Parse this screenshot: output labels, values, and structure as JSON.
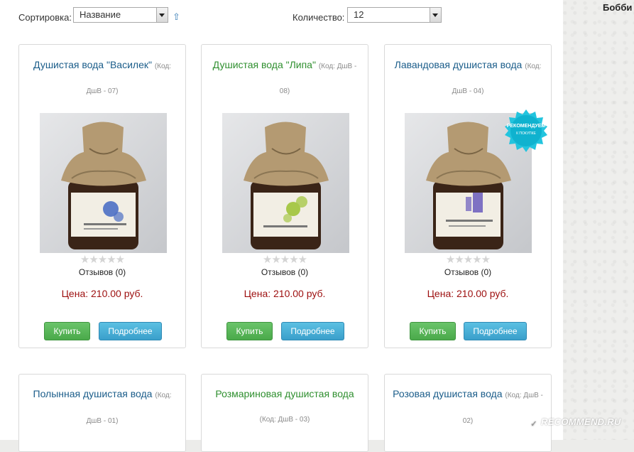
{
  "header": {
    "user_name": "Бобби"
  },
  "toolbar": {
    "sort_label": "Сортировка:",
    "sort_value": "Название",
    "quantity_label": "Количество:",
    "quantity_value": "12"
  },
  "products": [
    {
      "name": "Душистая вода \"Василек\"",
      "code_part1": "(Код:",
      "code_part2": "ДшВ - 07)",
      "title_color": "#1b5d8a",
      "label_text": "Душистая вода Василек",
      "flower_color": "#4d6fc4",
      "reviews": "Отзывов (0)",
      "price": "Цена: 210.00 руб.",
      "buy_label": "Купить",
      "details_label": "Подробнее",
      "rating": 0
    },
    {
      "name": "Душистая вода \"Липа\"",
      "code_part1": "(Код: ДшВ -",
      "code_part2": "08)",
      "title_color": "#2f8f2f",
      "label_text": "Душистая вода Липа",
      "flower_color": "#a8c84a",
      "reviews": "Отзывов (0)",
      "price": "Цена: 210.00 руб.",
      "buy_label": "Купить",
      "details_label": "Подробнее",
      "rating": 0
    },
    {
      "name": "Лавандовая душистая вода",
      "code_part1": "(Код:",
      "code_part2": "ДшВ - 04)",
      "title_color": "#1b5d8a",
      "label_text": "Лавандовая душистая вода",
      "flower_color": "#6a5bbd",
      "reviews": "Отзывов (0)",
      "price": "Цена: 210.00 руб.",
      "buy_label": "Купить",
      "details_label": "Подробнее",
      "rating": 0,
      "badge_line1": "РЕКОМЕНДУЕМ",
      "badge_line2": "К ПОКУПКЕ"
    },
    {
      "name": "Полынная душистая вода",
      "code_part1": "(Код:",
      "code_part2": "ДшВ - 01)",
      "title_color": "#1b5d8a"
    },
    {
      "name": "Розмариновая душистая вода",
      "code_part1": "",
      "code_part2": "(Код: ДшВ - 03)",
      "title_color": "#2f8f2f"
    },
    {
      "name": "Розовая душистая вода",
      "code_part1": "(Код: ДшВ -",
      "code_part2": "02)",
      "title_color": "#1b5d8a"
    }
  ],
  "watermark": "RECOMMEND.RU"
}
